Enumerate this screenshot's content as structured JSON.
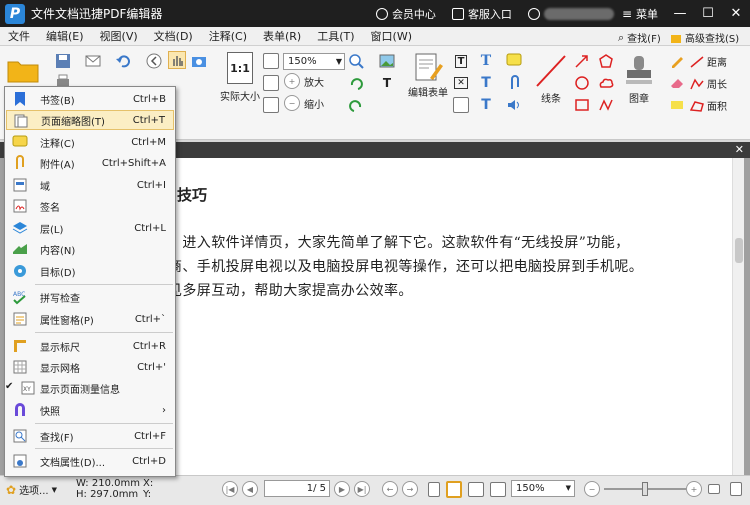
{
  "app": {
    "title": "文件文档迅捷PDF编辑器",
    "logo_letter": "P",
    "member_center": "会员中心",
    "support": "客服入口",
    "menu_label": "菜单",
    "win_min": "—",
    "win_max": "☐",
    "win_close": "✕"
  },
  "menubar": [
    "文件",
    "编辑(E)",
    "视图(V)",
    "文档(D)",
    "注释(C)",
    "表单(R)",
    "工具(T)",
    "窗口(W)"
  ],
  "ribbon": {
    "actual_size": "实际大小",
    "actual_size_icon": "1:1",
    "zoom_value": "150%",
    "zoom_in": "放大",
    "zoom_out": "缩小",
    "edit_form": "编辑表单",
    "line": "线条",
    "stamp": "图章",
    "find": "查找(F)",
    "advanced_find": "高级查找(S)",
    "distance": "距离",
    "perimeter": "周长",
    "area": "面积"
  },
  "document": {
    "heading": "技巧",
    "lines": [
      "，进入软件详情页，大家先简单了解下它。这款软件有“无线投屏”功能，",
      "商、手机投屏电视以及电脑投屏电视等操作，还可以把电脑投屏到手机呢。",
      "见多屏互动，帮助大家提高办公效率。"
    ]
  },
  "dropdown": [
    {
      "label": "书签(B)",
      "shortcut": "Ctrl+B",
      "icon": "bookmark-icon"
    },
    {
      "label": "页面缩略图(T)",
      "shortcut": "Ctrl+T",
      "icon": "page-thumbnail-icon",
      "selected": true
    },
    {
      "label": "注释(C)",
      "shortcut": "Ctrl+M",
      "icon": "comment-icon"
    },
    {
      "label": "附件(A)",
      "shortcut": "Ctrl+Shift+A",
      "icon": "attachment-icon"
    },
    {
      "label": "域",
      "shortcut": "Ctrl+I",
      "icon": "field-icon"
    },
    {
      "label": "签名",
      "shortcut": "",
      "icon": "signature-icon"
    },
    {
      "label": "层(L)",
      "shortcut": "Ctrl+L",
      "icon": "layers-icon"
    },
    {
      "label": "内容(N)",
      "shortcut": "",
      "icon": "content-icon"
    },
    {
      "label": "目标(D)",
      "shortcut": "",
      "icon": "destination-icon"
    },
    {
      "label": "拼写检查",
      "shortcut": "",
      "icon": "spellcheck-icon"
    },
    {
      "label": "属性窗格(P)",
      "shortcut": "Ctrl+`",
      "icon": "properties-pane-icon"
    },
    {
      "label": "显示标尺",
      "shortcut": "Ctrl+R",
      "icon": "ruler-icon"
    },
    {
      "label": "显示网格",
      "shortcut": "Ctrl+'",
      "icon": "grid-icon"
    },
    {
      "label": "显示页面测量信息",
      "shortcut": "",
      "icon": "measure-info-icon",
      "checked": true
    },
    {
      "label": "快照",
      "shortcut": "",
      "icon": "snapshot-icon",
      "submenu": true
    },
    {
      "label": "查找(F)",
      "shortcut": "Ctrl+F",
      "icon": "find-icon"
    },
    {
      "label": "文档属性(D)...",
      "shortcut": "Ctrl+D",
      "icon": "document-properties-icon"
    }
  ],
  "statusbar": {
    "options": "选项...",
    "width": "W: 210.0mm",
    "height": "H: 297.0mm",
    "x": "X:",
    "y": "Y:",
    "page_input": "1",
    "page_total": "/ 5",
    "zoom": "150%"
  },
  "colors": {
    "titlebar": "#1f1f1f",
    "accent_blue": "#2b86d8",
    "selected_bg": "#fbeec4"
  }
}
